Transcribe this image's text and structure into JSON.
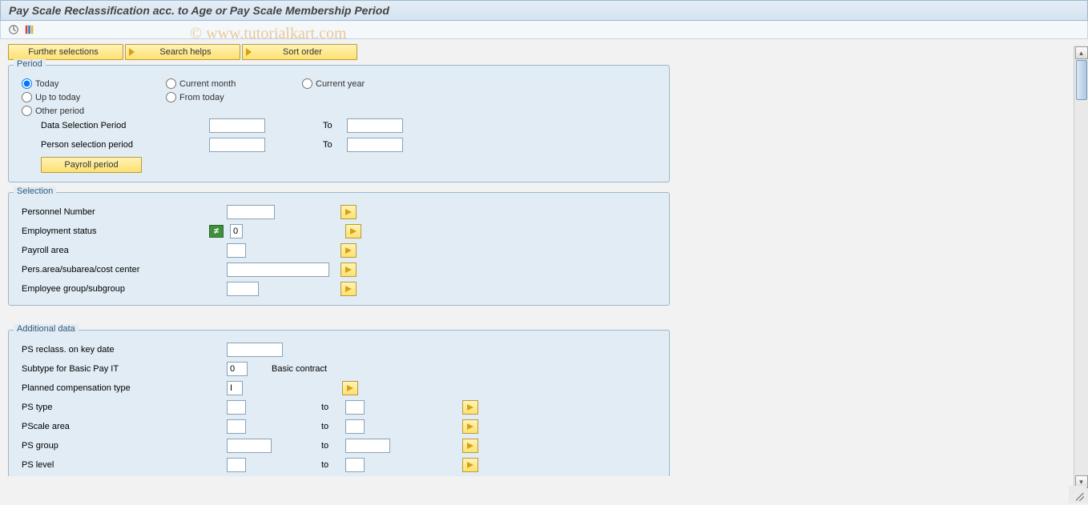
{
  "title": "Pay Scale Reclassification acc. to Age or Pay Scale Membership Period",
  "watermark": "© www.tutorialkart.com",
  "buttons_row": {
    "further_selections": "Further selections",
    "search_helps": "Search helps",
    "sort_order": "Sort order"
  },
  "period": {
    "legend": "Period",
    "today": "Today",
    "current_month": "Current month",
    "current_year": "Current year",
    "up_to_today": "Up to today",
    "from_today": "From today",
    "other_period": "Other period",
    "data_selection_period": "Data Selection Period",
    "person_selection_period": "Person selection period",
    "to": "To",
    "payroll_period_btn": "Payroll period"
  },
  "selection": {
    "legend": "Selection",
    "personnel_number": "Personnel Number",
    "employment_status": "Employment status",
    "employment_status_val": "0",
    "payroll_area": "Payroll area",
    "pers_area": "Pers.area/subarea/cost center",
    "employee_group": "Employee group/subgroup"
  },
  "additional": {
    "legend": "Additional data",
    "ps_reclass": "PS reclass. on key date",
    "subtype_label": "Subtype for Basic Pay IT",
    "subtype_val": "0",
    "subtype_desc": "Basic contract",
    "planned_comp": "Planned compensation type",
    "planned_comp_val": "I",
    "to": "to",
    "ps_type": "PS type",
    "pscale_area": "PScale area",
    "ps_group": "PS group",
    "ps_level": "PS level"
  }
}
